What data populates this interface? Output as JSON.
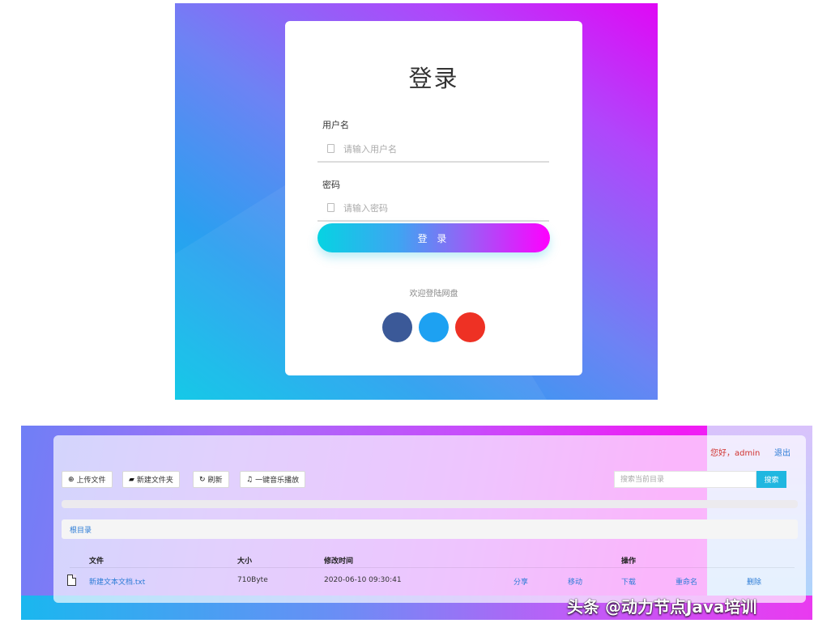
{
  "login": {
    "title": "登录",
    "username": {
      "label": "用户名",
      "placeholder": "请输入用户名"
    },
    "password": {
      "label": "密码",
      "placeholder": "请输入密码"
    },
    "submit_label": "登 录",
    "welcome": "欢迎登陆网盘",
    "social_colors": [
      "#3b5998",
      "#1da1f2",
      "#ee3124"
    ]
  },
  "drive": {
    "greeting": "您好，admin",
    "logout": "退出",
    "toolbar": {
      "upload": {
        "icon": "upload-icon",
        "label": "上传文件"
      },
      "new_folder": {
        "icon": "folder-open-icon",
        "label": "新建文件夹"
      },
      "refresh": {
        "icon": "refresh-icon",
        "label": "刷新"
      },
      "play_music": {
        "icon": "music-note-icon",
        "label": "一键音乐播放"
      }
    },
    "search": {
      "placeholder": "搜索当前目录",
      "button": "搜索"
    },
    "progress": 0,
    "breadcrumb": "根目录",
    "table": {
      "headers": {
        "name": "文件",
        "size": "大小",
        "modified": "修改时间",
        "actions": "操作"
      },
      "rows": [
        {
          "icon": "file-icon",
          "name": "新建文本文档.txt",
          "size": "710Byte",
          "modified": "2020-06-10 09:30:41",
          "actions": {
            "share": "分享",
            "move": "移动",
            "download": "下载",
            "rename": "重命名",
            "delete": "删除"
          }
        }
      ]
    }
  },
  "watermark": "头条 @动力节点Java培训",
  "colors": {
    "accent": "#20b7e0",
    "link": "#2b7bd6",
    "greeting": "#d0332f"
  }
}
